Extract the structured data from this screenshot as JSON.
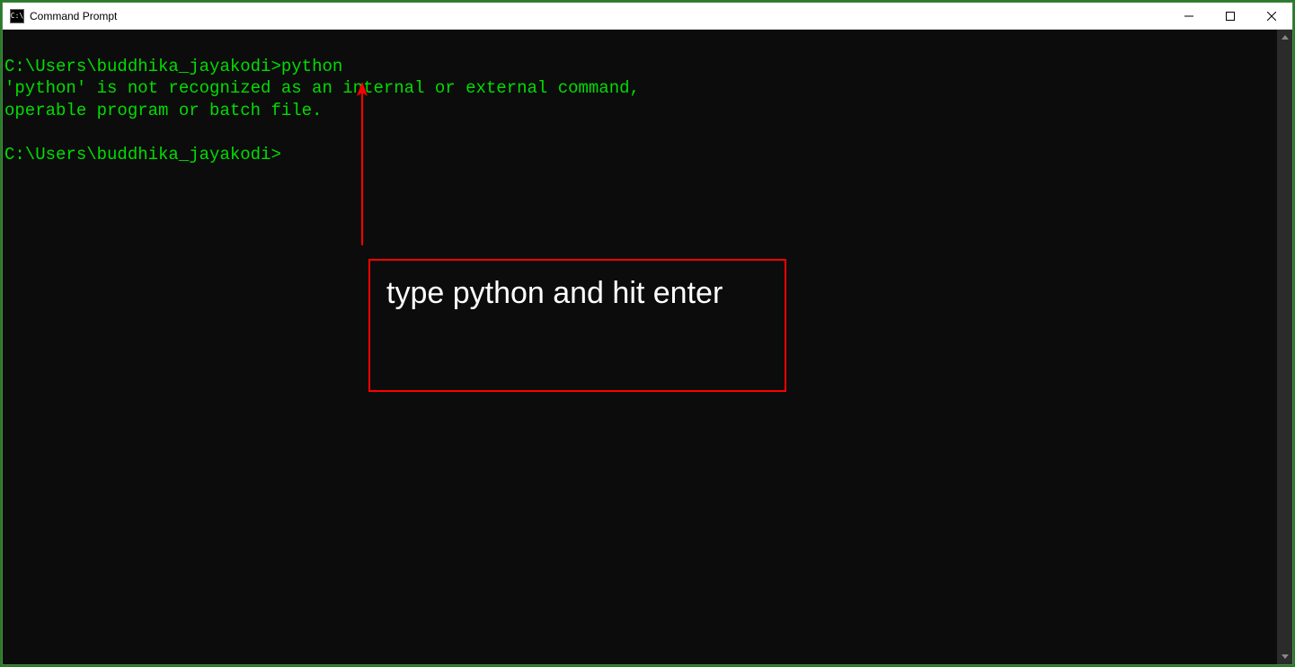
{
  "window": {
    "title": "Command Prompt",
    "icon_label": "C:\\"
  },
  "terminal": {
    "line1_prompt": "C:\\Users\\buddhika_jayakodi>",
    "line1_cmd": "python",
    "line2": "'python' is not recognized as an internal or external command,",
    "line3": "operable program or batch file.",
    "line5_prompt": "C:\\Users\\buddhika_jayakodi>"
  },
  "annotation": {
    "text": "type python and hit enter",
    "arrow_color": "#ff0000",
    "box_border_color": "#ff0000"
  },
  "colors": {
    "terminal_bg": "#0c0c0c",
    "terminal_fg": "#00dd00"
  }
}
